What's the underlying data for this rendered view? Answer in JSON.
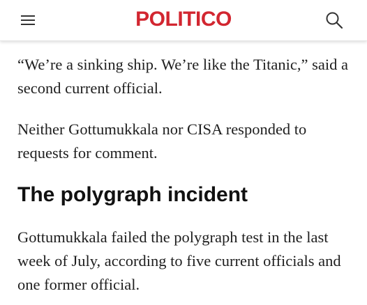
{
  "header": {
    "logo": "POLITICO",
    "logo_color": "#d22630",
    "menu_icon": "hamburger-menu-icon",
    "search_icon": "search-icon"
  },
  "article": {
    "paragraphs": [
      "“We’re a sinking ship. We’re like the Titanic,” said a second current official.",
      "Neither Gottumukkala nor CISA responded to requests for comment.",
      "Gottumukkala failed the polygraph test in the last week of July, according to five current officials and one former official."
    ],
    "subheading": "The polygraph incident"
  }
}
